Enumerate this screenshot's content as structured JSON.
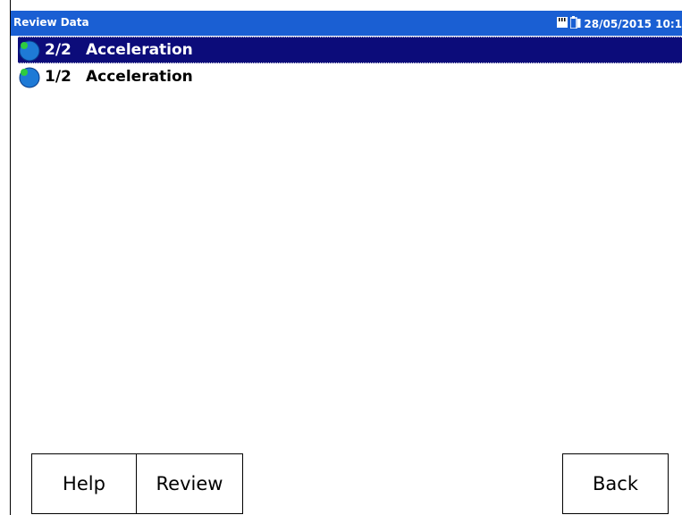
{
  "titlebar": {
    "title": "Review Data",
    "datetime": "28/05/2015 10:1",
    "status_icons": [
      "memory-card-icon",
      "battery-icon"
    ]
  },
  "list": {
    "items": [
      {
        "index": "2/2",
        "label": "Acceleration",
        "selected": true,
        "icon": "node-dot-icon"
      },
      {
        "index": "1/2",
        "label": "Acceleration",
        "selected": false,
        "icon": "node-dot-icon"
      }
    ]
  },
  "buttons": {
    "help": "Help",
    "review": "Review",
    "back": "Back"
  },
  "colors": {
    "titlebar_bg": "#1a5fd3",
    "selection_bg": "#0c0c7a",
    "dot_blue": "#1e7ad6",
    "dot_green": "#2ecc40"
  }
}
